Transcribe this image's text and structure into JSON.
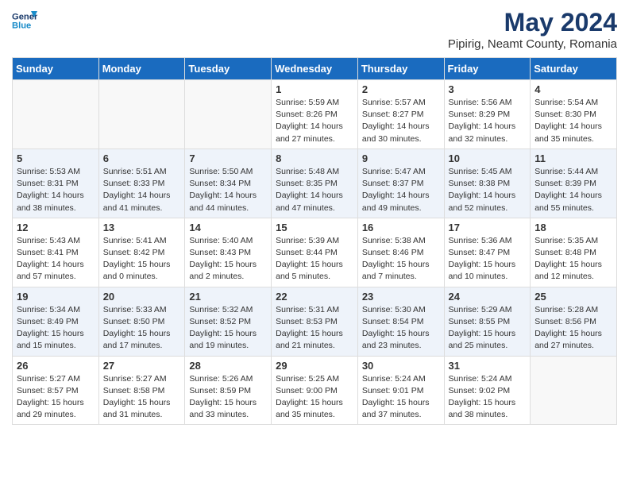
{
  "header": {
    "logo_line1": "General",
    "logo_line2": "Blue",
    "month_year": "May 2024",
    "location": "Pipirig, Neamt County, Romania"
  },
  "days_of_week": [
    "Sunday",
    "Monday",
    "Tuesday",
    "Wednesday",
    "Thursday",
    "Friday",
    "Saturday"
  ],
  "weeks": [
    [
      {
        "day": "",
        "info": ""
      },
      {
        "day": "",
        "info": ""
      },
      {
        "day": "",
        "info": ""
      },
      {
        "day": "1",
        "info": "Sunrise: 5:59 AM\nSunset: 8:26 PM\nDaylight: 14 hours\nand 27 minutes."
      },
      {
        "day": "2",
        "info": "Sunrise: 5:57 AM\nSunset: 8:27 PM\nDaylight: 14 hours\nand 30 minutes."
      },
      {
        "day": "3",
        "info": "Sunrise: 5:56 AM\nSunset: 8:29 PM\nDaylight: 14 hours\nand 32 minutes."
      },
      {
        "day": "4",
        "info": "Sunrise: 5:54 AM\nSunset: 8:30 PM\nDaylight: 14 hours\nand 35 minutes."
      }
    ],
    [
      {
        "day": "5",
        "info": "Sunrise: 5:53 AM\nSunset: 8:31 PM\nDaylight: 14 hours\nand 38 minutes."
      },
      {
        "day": "6",
        "info": "Sunrise: 5:51 AM\nSunset: 8:33 PM\nDaylight: 14 hours\nand 41 minutes."
      },
      {
        "day": "7",
        "info": "Sunrise: 5:50 AM\nSunset: 8:34 PM\nDaylight: 14 hours\nand 44 minutes."
      },
      {
        "day": "8",
        "info": "Sunrise: 5:48 AM\nSunset: 8:35 PM\nDaylight: 14 hours\nand 47 minutes."
      },
      {
        "day": "9",
        "info": "Sunrise: 5:47 AM\nSunset: 8:37 PM\nDaylight: 14 hours\nand 49 minutes."
      },
      {
        "day": "10",
        "info": "Sunrise: 5:45 AM\nSunset: 8:38 PM\nDaylight: 14 hours\nand 52 minutes."
      },
      {
        "day": "11",
        "info": "Sunrise: 5:44 AM\nSunset: 8:39 PM\nDaylight: 14 hours\nand 55 minutes."
      }
    ],
    [
      {
        "day": "12",
        "info": "Sunrise: 5:43 AM\nSunset: 8:41 PM\nDaylight: 14 hours\nand 57 minutes."
      },
      {
        "day": "13",
        "info": "Sunrise: 5:41 AM\nSunset: 8:42 PM\nDaylight: 15 hours\nand 0 minutes."
      },
      {
        "day": "14",
        "info": "Sunrise: 5:40 AM\nSunset: 8:43 PM\nDaylight: 15 hours\nand 2 minutes."
      },
      {
        "day": "15",
        "info": "Sunrise: 5:39 AM\nSunset: 8:44 PM\nDaylight: 15 hours\nand 5 minutes."
      },
      {
        "day": "16",
        "info": "Sunrise: 5:38 AM\nSunset: 8:46 PM\nDaylight: 15 hours\nand 7 minutes."
      },
      {
        "day": "17",
        "info": "Sunrise: 5:36 AM\nSunset: 8:47 PM\nDaylight: 15 hours\nand 10 minutes."
      },
      {
        "day": "18",
        "info": "Sunrise: 5:35 AM\nSunset: 8:48 PM\nDaylight: 15 hours\nand 12 minutes."
      }
    ],
    [
      {
        "day": "19",
        "info": "Sunrise: 5:34 AM\nSunset: 8:49 PM\nDaylight: 15 hours\nand 15 minutes."
      },
      {
        "day": "20",
        "info": "Sunrise: 5:33 AM\nSunset: 8:50 PM\nDaylight: 15 hours\nand 17 minutes."
      },
      {
        "day": "21",
        "info": "Sunrise: 5:32 AM\nSunset: 8:52 PM\nDaylight: 15 hours\nand 19 minutes."
      },
      {
        "day": "22",
        "info": "Sunrise: 5:31 AM\nSunset: 8:53 PM\nDaylight: 15 hours\nand 21 minutes."
      },
      {
        "day": "23",
        "info": "Sunrise: 5:30 AM\nSunset: 8:54 PM\nDaylight: 15 hours\nand 23 minutes."
      },
      {
        "day": "24",
        "info": "Sunrise: 5:29 AM\nSunset: 8:55 PM\nDaylight: 15 hours\nand 25 minutes."
      },
      {
        "day": "25",
        "info": "Sunrise: 5:28 AM\nSunset: 8:56 PM\nDaylight: 15 hours\nand 27 minutes."
      }
    ],
    [
      {
        "day": "26",
        "info": "Sunrise: 5:27 AM\nSunset: 8:57 PM\nDaylight: 15 hours\nand 29 minutes."
      },
      {
        "day": "27",
        "info": "Sunrise: 5:27 AM\nSunset: 8:58 PM\nDaylight: 15 hours\nand 31 minutes."
      },
      {
        "day": "28",
        "info": "Sunrise: 5:26 AM\nSunset: 8:59 PM\nDaylight: 15 hours\nand 33 minutes."
      },
      {
        "day": "29",
        "info": "Sunrise: 5:25 AM\nSunset: 9:00 PM\nDaylight: 15 hours\nand 35 minutes."
      },
      {
        "day": "30",
        "info": "Sunrise: 5:24 AM\nSunset: 9:01 PM\nDaylight: 15 hours\nand 37 minutes."
      },
      {
        "day": "31",
        "info": "Sunrise: 5:24 AM\nSunset: 9:02 PM\nDaylight: 15 hours\nand 38 minutes."
      },
      {
        "day": "",
        "info": ""
      }
    ]
  ]
}
